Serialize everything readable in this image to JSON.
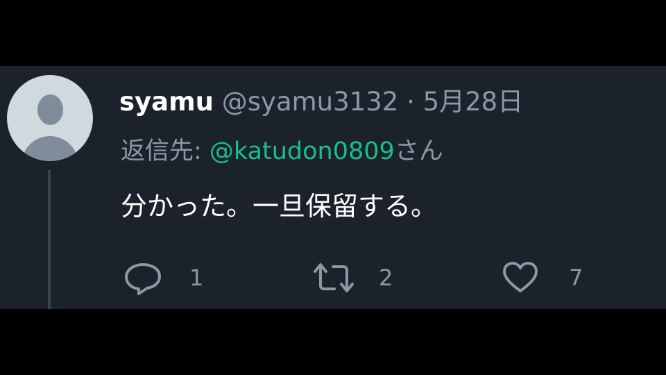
{
  "tweet": {
    "author": {
      "display_name": "syamu",
      "handle": "@syamu3132"
    },
    "separator": "·",
    "date": "5月28日",
    "reply_prefix": "返信先: ",
    "reply_to": "@katudon0809",
    "reply_suffix": "さん",
    "text": "分かった。一旦保留する。",
    "actions": {
      "reply": {
        "icon": "reply-icon",
        "count": "1"
      },
      "retweet": {
        "icon": "retweet-icon",
        "count": "2"
      },
      "like": {
        "icon": "heart-icon",
        "count": "7"
      }
    }
  },
  "colors": {
    "background": "#1c222b",
    "mention": "#17bf8a",
    "secondary_text": "#8b98a5",
    "primary_text": "#ffffff"
  }
}
